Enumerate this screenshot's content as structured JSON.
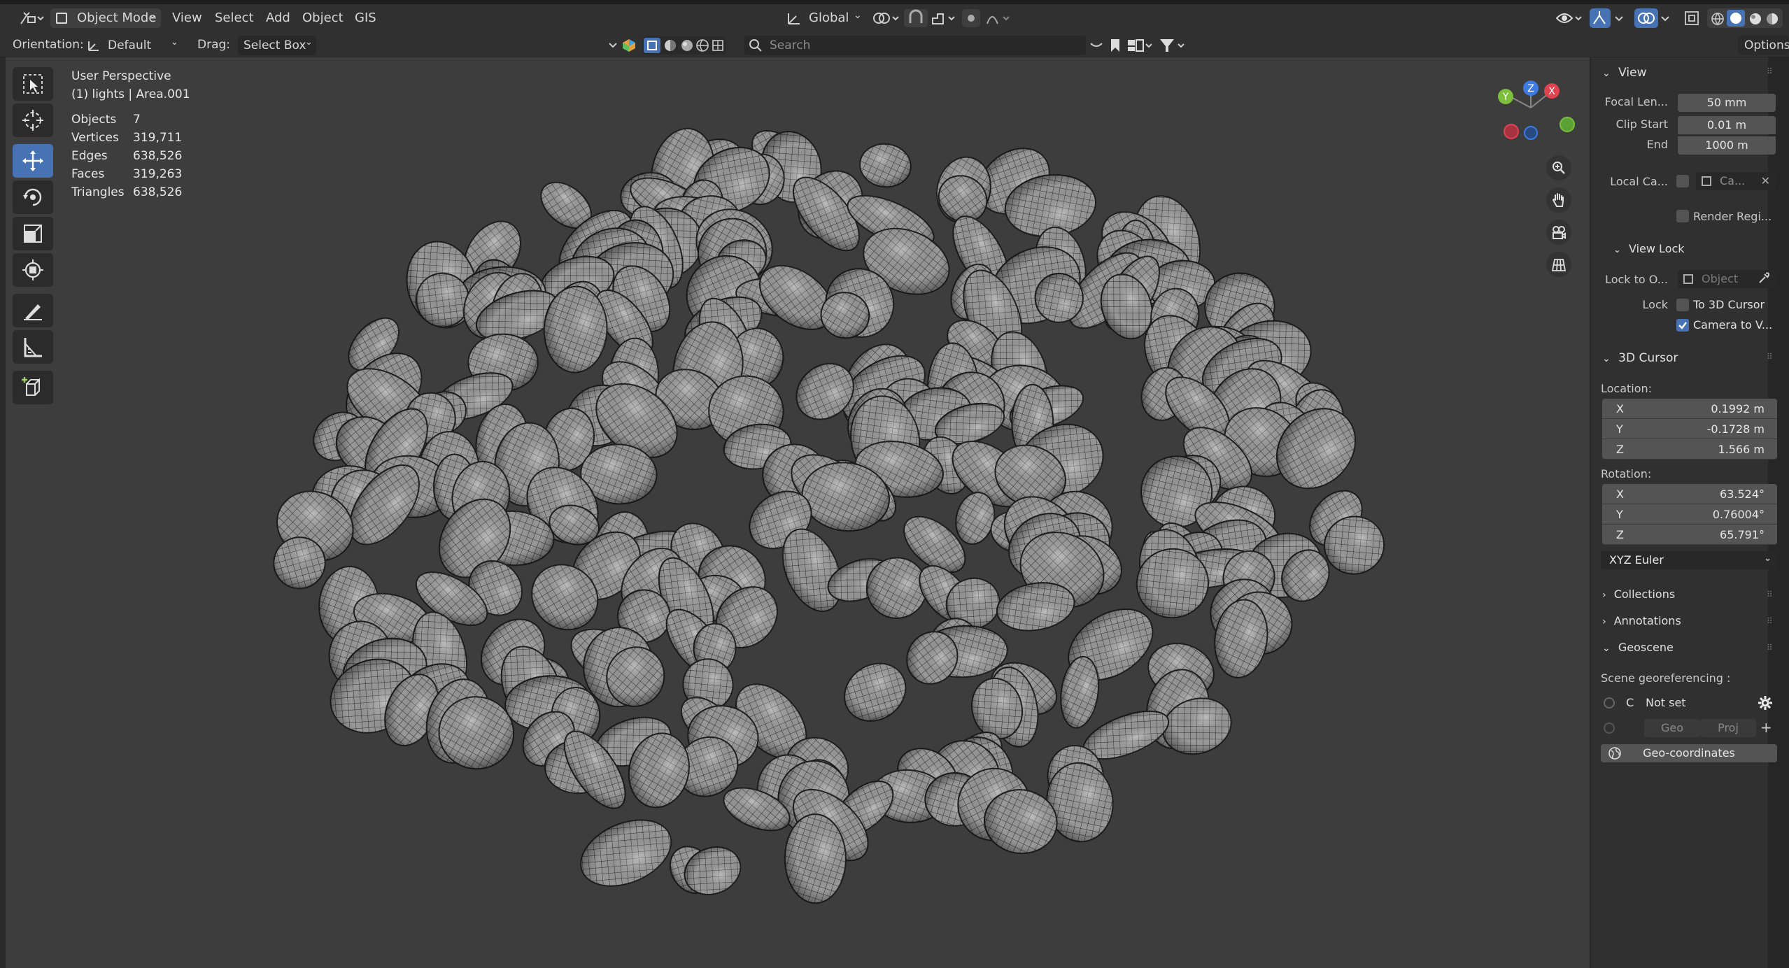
{
  "header": {
    "mode": "Object Mode",
    "menu": [
      "View",
      "Select",
      "Add",
      "Object",
      "GIS"
    ],
    "transform_orientation": "Global",
    "options_label": "Options"
  },
  "toolrow": {
    "orientation_label": "Orientation:",
    "orientation_value": "Default",
    "drag_label": "Drag:",
    "drag_value": "Select Box",
    "search_placeholder": "Search"
  },
  "overlay": {
    "perspective": "User Perspective",
    "context": "(1) lights | Area.001",
    "stats": [
      {
        "label": "Objects",
        "value": "7"
      },
      {
        "label": "Vertices",
        "value": "319,711"
      },
      {
        "label": "Edges",
        "value": "638,526"
      },
      {
        "label": "Faces",
        "value": "319,263"
      },
      {
        "label": "Triangles",
        "value": "638,526"
      }
    ]
  },
  "gizmo": {
    "x": "X",
    "y": "Y",
    "z": "Z"
  },
  "sidebar": {
    "view": {
      "title": "View",
      "focal_label": "Focal Len...",
      "focal_value": "50 mm",
      "clip_start_label": "Clip Start",
      "clip_start_value": "0.01 m",
      "end_label": "End",
      "end_value": "1000 m",
      "local_camera_label": "Local Ca...",
      "local_camera_value": "Ca...",
      "render_region_label": "Render Regi..."
    },
    "view_lock": {
      "title": "View Lock",
      "lock_to_label": "Lock to O...",
      "lock_to_placeholder": "Object",
      "lock_label": "Lock",
      "to_cursor_label": "To 3D Cursor",
      "camera_label": "Camera to V..."
    },
    "cursor": {
      "title": "3D Cursor",
      "location_label": "Location:",
      "location": [
        {
          "axis": "X",
          "value": "0.1992 m"
        },
        {
          "axis": "Y",
          "value": "-0.1728 m"
        },
        {
          "axis": "Z",
          "value": "1.566 m"
        }
      ],
      "rotation_label": "Rotation:",
      "rotation": [
        {
          "axis": "X",
          "value": "63.524°"
        },
        {
          "axis": "Y",
          "value": "0.76004°"
        },
        {
          "axis": "Z",
          "value": "65.791°"
        }
      ],
      "rotation_mode": "XYZ Euler"
    },
    "collections": "Collections",
    "annotations": "Annotations",
    "geoscene": {
      "title": "Geoscene",
      "scene_label": "Scene georeferencing :",
      "c_label": "C",
      "not_set": "Not set",
      "geo": "Geo",
      "proj": "Proj",
      "geo_coordinates": "Geo-coordinates"
    }
  }
}
